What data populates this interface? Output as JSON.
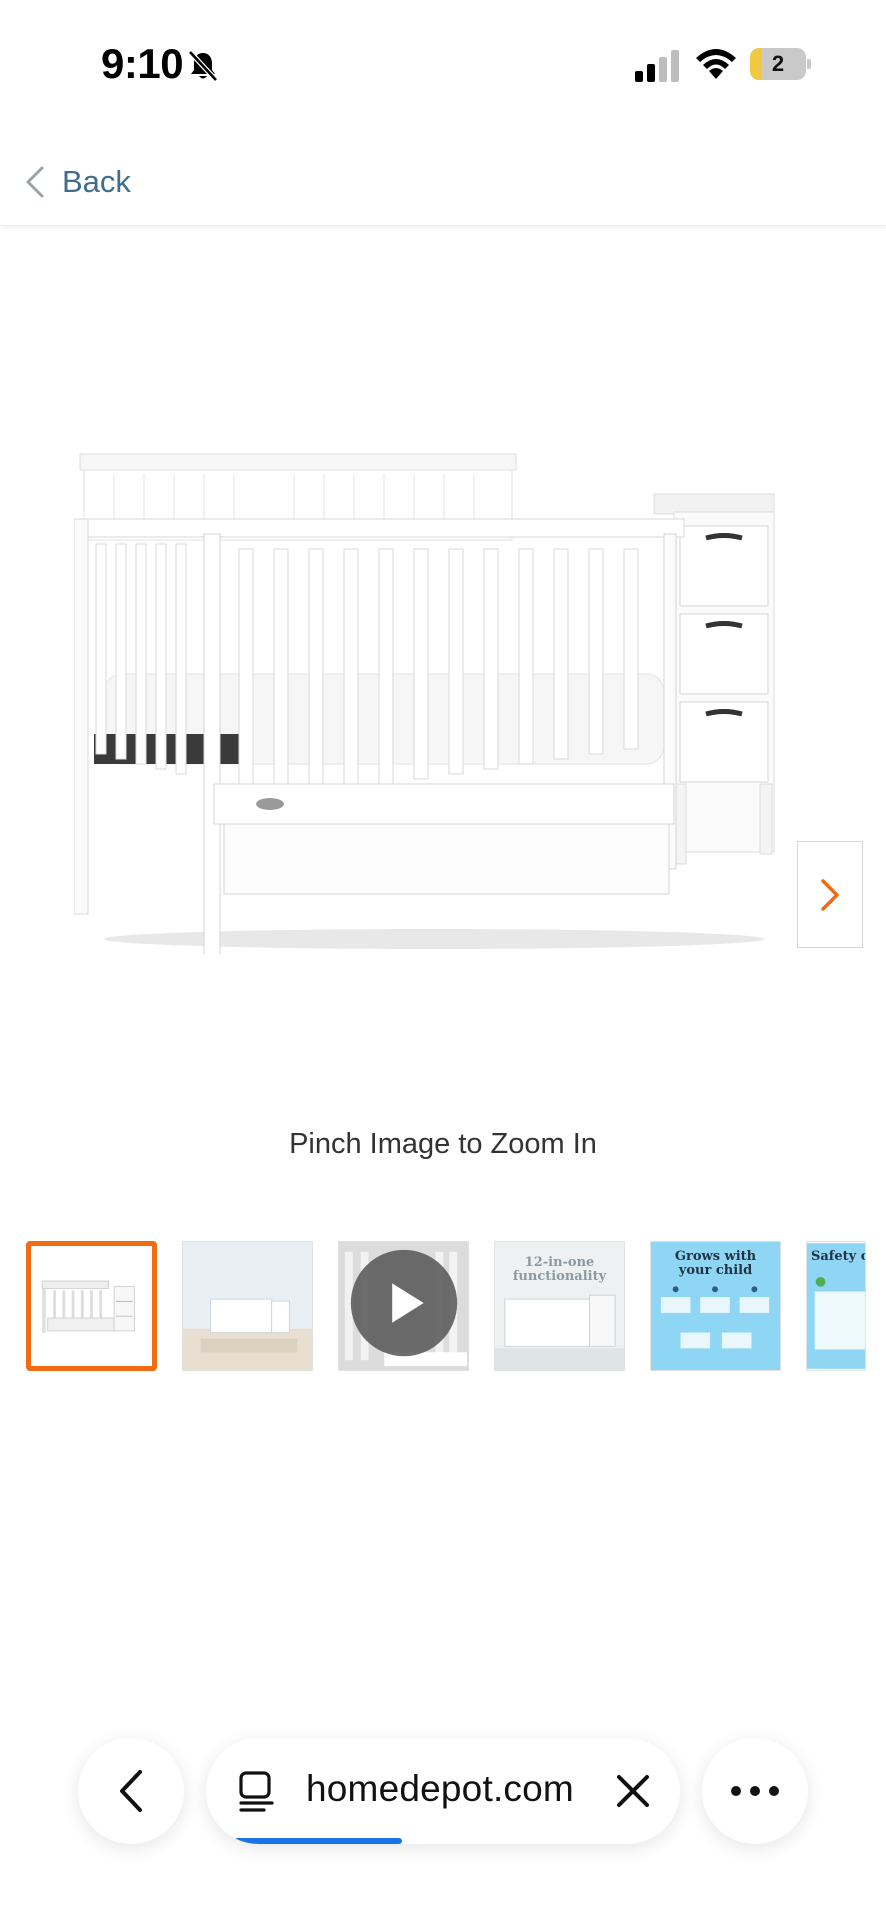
{
  "status_bar": {
    "time": "9:10",
    "battery_level": "2",
    "battery_fill_percent": 20,
    "icons": [
      "bell-slash-icon",
      "cellular-signal-icon",
      "wifi-icon",
      "battery-icon"
    ]
  },
  "header": {
    "back_label": "Back",
    "back_icon": "chevron-left-icon"
  },
  "product_image": {
    "alt": "",
    "next_icon": "chevron-right-icon"
  },
  "zoom_hint": "Pinch Image to Zoom In",
  "thumbnails": [
    {
      "kind": "image",
      "selected": true,
      "text": ""
    },
    {
      "kind": "image",
      "selected": false,
      "text": ""
    },
    {
      "kind": "video",
      "selected": false,
      "text": ""
    },
    {
      "kind": "image",
      "selected": false,
      "text": "12-in-one functionality"
    },
    {
      "kind": "image",
      "selected": false,
      "text": "Grows with your child"
    },
    {
      "kind": "image",
      "selected": false,
      "text": "Safety certified"
    }
  ],
  "browser": {
    "url": "homedepot.com",
    "load_progress": 0.37,
    "icons": [
      "back-chevron-icon",
      "tab-list-icon",
      "close-icon",
      "more-icon"
    ]
  },
  "colors": {
    "accent": "#f06c13",
    "link": "#3f6e8c",
    "progress": "#1a73e8"
  }
}
